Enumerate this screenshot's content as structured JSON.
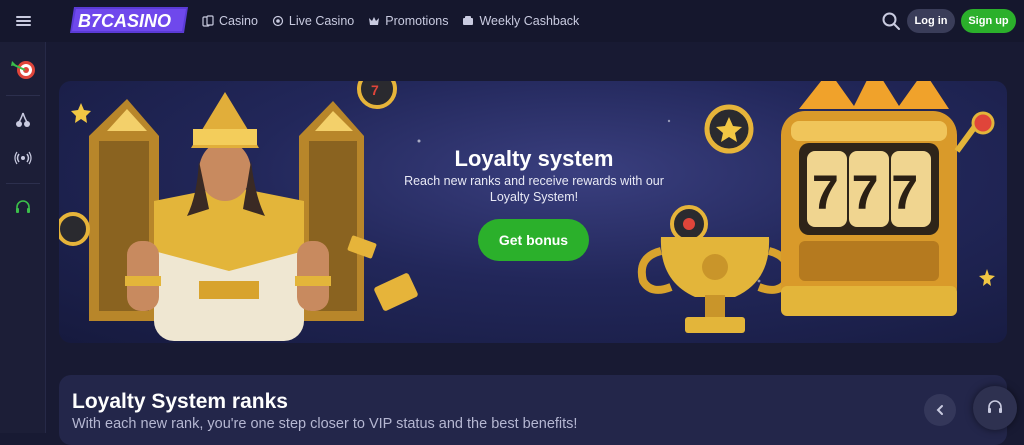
{
  "header": {
    "logo_text": "B7CASINO",
    "nav": [
      {
        "label": "Casino",
        "icon": "cards-icon"
      },
      {
        "label": "Live Casino",
        "icon": "live-icon"
      },
      {
        "label": "Promotions",
        "icon": "crown-icon"
      },
      {
        "label": "Weekly Cashback",
        "icon": "cashback-icon"
      }
    ],
    "login_label": "Log in",
    "signup_label": "Sign up"
  },
  "sidebar": {
    "items": [
      {
        "name": "target-icon"
      },
      {
        "name": "cherries-icon"
      },
      {
        "name": "live-stream-icon"
      },
      {
        "name": "headset-icon"
      }
    ]
  },
  "banner": {
    "title": "Loyalty system",
    "subtitle": "Reach new ranks and receive rewards with our Loyalty System!",
    "button_label": "Get bonus",
    "slot_digits": "777"
  },
  "ranks": {
    "title": "Loyalty System ranks",
    "subtitle": "With each new rank, you're one step closer to VIP status and the best benefits!"
  },
  "colors": {
    "accent_green": "#2bb02b",
    "logo_purple": "#6a3fe0",
    "background": "#181a33"
  }
}
